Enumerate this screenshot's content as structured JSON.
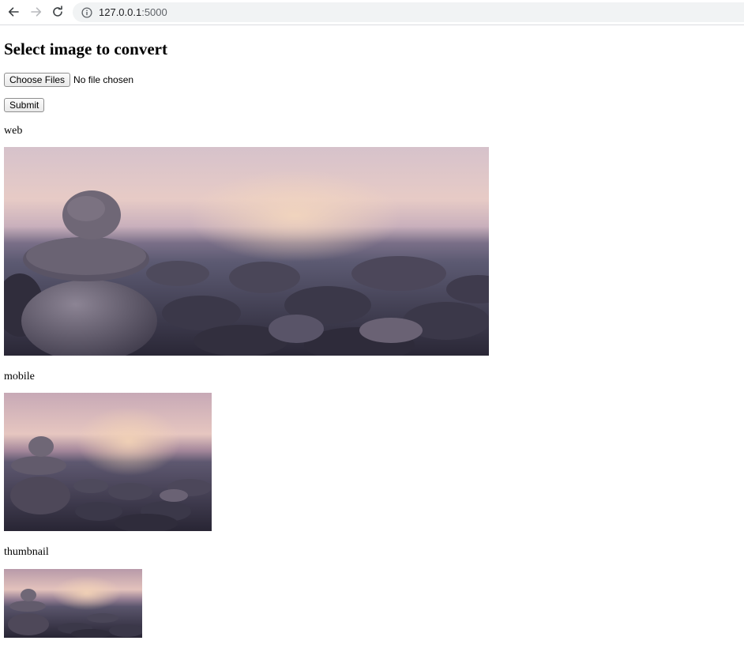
{
  "browser": {
    "url_host": "127.0.0.1",
    "url_port": ":5000",
    "back_icon": "arrow-left-icon",
    "forward_icon": "arrow-right-icon",
    "reload_icon": "reload-icon",
    "site_info_icon": "info-icon"
  },
  "page": {
    "title": "Select image to convert",
    "choose_button": "Choose Files",
    "file_status": "No file chosen",
    "submit_button": "Submit"
  },
  "images": [
    {
      "label": "web"
    },
    {
      "label": "mobile"
    },
    {
      "label": "thumbnail"
    }
  ]
}
